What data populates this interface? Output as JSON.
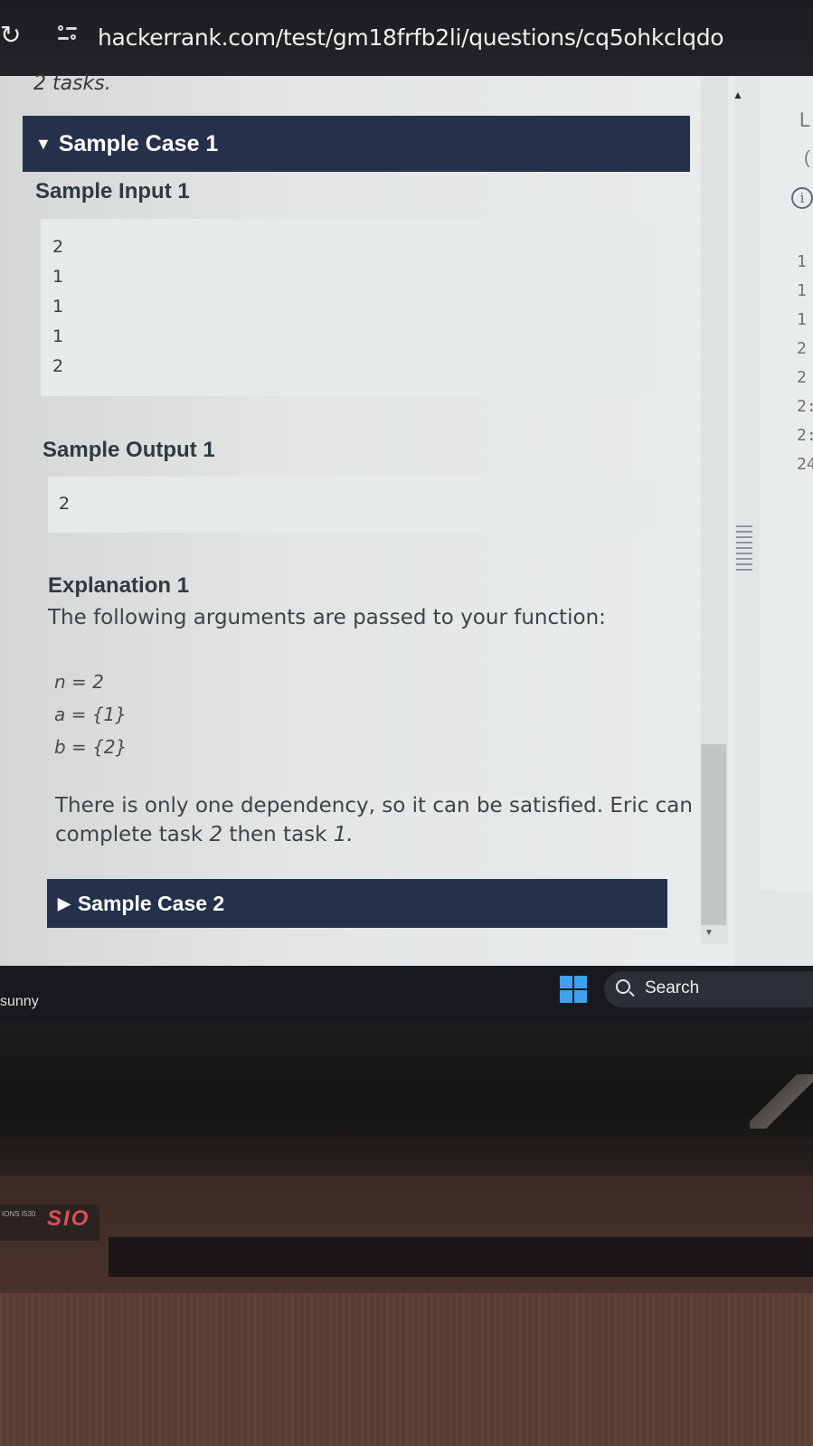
{
  "browser": {
    "url": "hackerrank.com/test/gm18frfb2li/questions/cq5ohkclqdo"
  },
  "problem": {
    "prev_text": "2 tasks.",
    "sample_case_1": {
      "title": "Sample Case 1",
      "input_label": "Sample Input 1",
      "input_lines": [
        "2",
        "1",
        "1",
        "1",
        "2"
      ],
      "output_label": "Sample Output 1",
      "output_lines": [
        "2"
      ],
      "explanation_label": "Explanation 1",
      "explanation_intro": "The following arguments are passed to your function:",
      "args": [
        "n = 2",
        "a = {1}",
        "b = {2}"
      ],
      "explanation_text_1": "There is only one dependency, so it can be satisfied. Eric can",
      "explanation_text_2a": "complete task ",
      "explanation_text_2b": "2",
      "explanation_text_2c": " then task ",
      "explanation_text_2d": "1."
    },
    "sample_case_2": {
      "title": "Sample Case 2"
    }
  },
  "right_panel": {
    "header_char": "L",
    "paren_char": "(",
    "line_numbers": [
      "1",
      "1",
      "1",
      "2",
      "2",
      "2:",
      "2:",
      "24"
    ]
  },
  "taskbar": {
    "weather": "sunny",
    "search_label": "Search"
  },
  "laptop": {
    "sticker_small": "IONS\nI530",
    "sticker_big": "SIO"
  }
}
